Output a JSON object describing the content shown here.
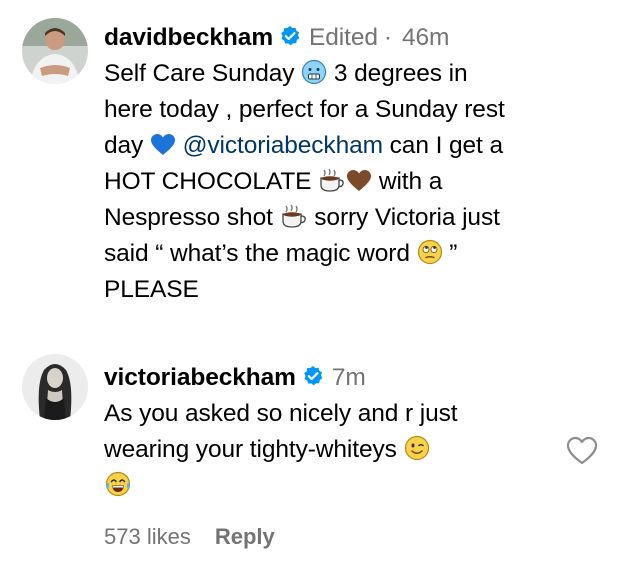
{
  "comment1": {
    "username": "davidbeckham",
    "edited": "Edited",
    "dot": "·",
    "time": "46m",
    "l1a": "Self Care Sunday",
    "l1b": "3 degrees in",
    "l2": "here today , perfect for a Sunday rest",
    "l3a": "day",
    "l3mention": "@victoriabeckham",
    "l3b": "can I get a",
    "l4a": "HOT CHOCOLATE",
    "l4b": "with a",
    "l5a": "Nespresso shot",
    "l5b": "sorry Victoria just",
    "l6a": "said “ what’s the magic word",
    "l6b": "”",
    "l7": "PLEASE"
  },
  "comment2": {
    "username": "victoriabeckham",
    "time": "7m",
    "l1": "As you asked so nicely and r just",
    "l2": "wearing your tighty-whiteys",
    "likes": "573 likes",
    "reply": "Reply"
  },
  "icons": {
    "verified": "verified-badge-icon",
    "cold_face": "cold-face-emoji",
    "blue_heart": "blue-heart-emoji",
    "hot_beverage": "hot-beverage-emoji",
    "brown_heart": "brown-heart-emoji",
    "eye_roll": "eye-roll-emoji",
    "wink": "winking-face-emoji",
    "laughing": "tears-of-joy-emoji",
    "like": "heart-outline-icon"
  },
  "colors": {
    "verified_blue": "#0095f6",
    "mention": "#00376b",
    "meta_gray": "#737373",
    "heart_blue": "#1e73d8",
    "heart_brown": "#7b4a2a"
  }
}
